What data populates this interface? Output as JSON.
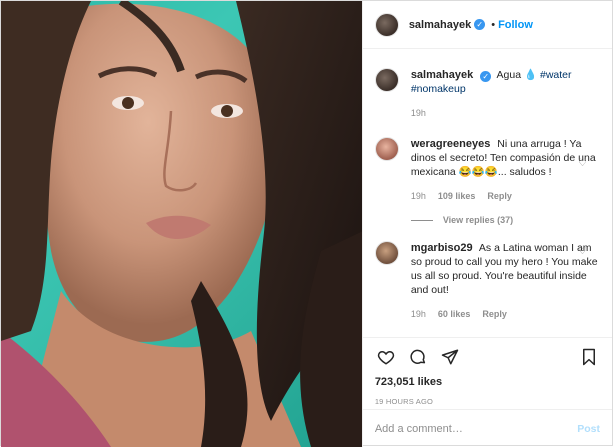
{
  "colors": {
    "link": "#0095f6",
    "hashtag": "#003569",
    "muted": "#8e8e8e",
    "verified": "#3897f0",
    "photo_bg": "#2bb8a6"
  },
  "header": {
    "username": "salmahayek",
    "follow_label": "Follow",
    "verified_icon": "verified-badge-icon"
  },
  "caption": {
    "username": "salmahayek",
    "text": "Agua ",
    "emoji": "💧",
    "hashtags": [
      "#water",
      "#nomakeup"
    ],
    "time": "19h"
  },
  "comments": [
    {
      "username": "weragreeneyes",
      "text": "Ni una arruga ! Ya dinos el secreto! Ten compasión de una mexicana 😂😂😂... saludos !",
      "time": "19h",
      "likes": "109 likes",
      "reply_label": "Reply",
      "view_replies": "View replies (37)"
    },
    {
      "username": "mgarbiso29",
      "text": "As a Latina woman I am so proud to call you my hero ! You make us all so proud. You're beautiful inside and out!",
      "time": "19h",
      "likes": "60 likes",
      "reply_label": "Reply"
    }
  ],
  "footer": {
    "likes": "723,051 likes",
    "time": "19 HOURS AGO",
    "comment_placeholder": "Add a comment…",
    "post_label": "Post",
    "icons": [
      "heart-icon",
      "comment-icon",
      "share-icon",
      "bookmark-icon"
    ]
  }
}
